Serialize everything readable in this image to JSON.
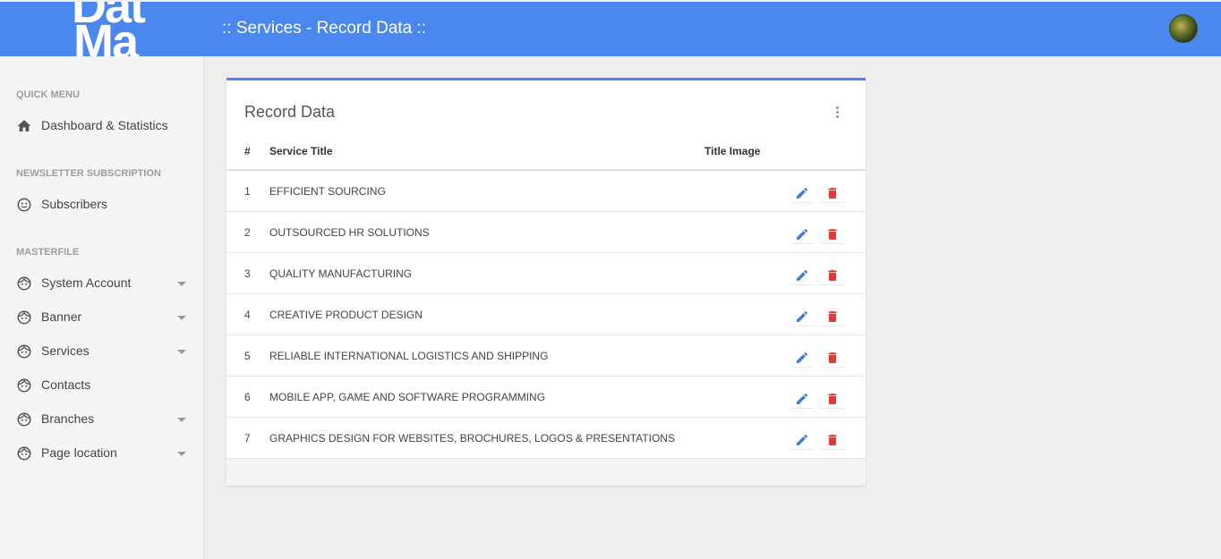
{
  "header": {
    "logo_line1": "Dat",
    "logo_line2": "Ma",
    "title": ":: Services - Record Data ::"
  },
  "sidebar": {
    "sections": [
      {
        "header": "QUICK MENU"
      },
      {
        "header": "NEWSLETTER SUBSCRIPTION"
      },
      {
        "header": "MASTERFILE"
      }
    ],
    "items": [
      {
        "label": "Dashboard & Statistics",
        "icon": "home-icon"
      },
      {
        "label": "Subscribers",
        "icon": "smiley-icon"
      },
      {
        "label": "System Account",
        "icon": "face-icon"
      },
      {
        "label": "Banner",
        "icon": "face-icon"
      },
      {
        "label": "Services",
        "icon": "face-icon"
      },
      {
        "label": "Contacts",
        "icon": "face-icon"
      },
      {
        "label": "Branches",
        "icon": "face-icon"
      },
      {
        "label": "Page location",
        "icon": "face-icon"
      }
    ]
  },
  "card": {
    "title": "Record Data",
    "columns": [
      "#",
      "Service Title",
      "Title Image"
    ],
    "rows": [
      {
        "num": "1",
        "title": "EFFICIENT SOURCING"
      },
      {
        "num": "2",
        "title": "OUTSOURCED HR SOLUTIONS"
      },
      {
        "num": "3",
        "title": "QUALITY MANUFACTURING"
      },
      {
        "num": "4",
        "title": "CREATIVE PRODUCT DESIGN"
      },
      {
        "num": "5",
        "title": "RELIABLE INTERNATIONAL LOGISTICS AND SHIPPING"
      },
      {
        "num": "6",
        "title": "MOBILE APP, GAME AND SOFTWARE PROGRAMMING"
      },
      {
        "num": "7",
        "title": "GRAPHICS DESIGN FOR WEBSITES, BROCHURES, LOGOS & PRESENTATIONS"
      }
    ]
  },
  "colors": {
    "accent": "#4a87ef",
    "edit": "#3b7de0",
    "delete": "#e53935"
  }
}
